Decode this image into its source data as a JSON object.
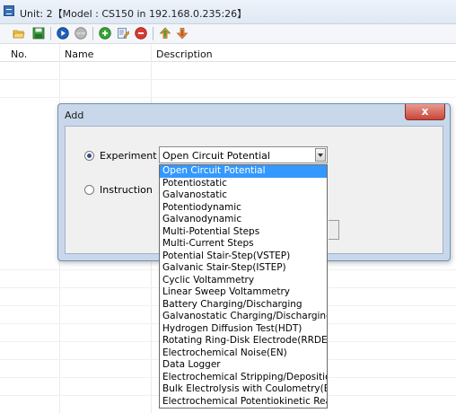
{
  "window": {
    "title": "Unit: 2【Model : CS150 in 192.168.0.235:26】"
  },
  "toolbar": {
    "icons": [
      "open-folder-icon",
      "save-icon",
      "play-icon",
      "stop-icon",
      "add-icon",
      "edit-icon",
      "remove-icon",
      "move-up-icon",
      "move-down-icon"
    ],
    "stop_text": "STOP"
  },
  "table": {
    "columns": [
      "No.",
      "Name",
      "Description"
    ]
  },
  "dialog": {
    "title": "Add",
    "close_label": "x",
    "experiment_label": "Experiment",
    "instruction_label": "Instruction",
    "experiment_checked": true,
    "combo_value": "Open Circuit Potential",
    "options": [
      "Open Circuit Potential",
      "Potentiostatic",
      "Galvanostatic",
      "Potentiodynamic",
      "Galvanodynamic",
      "Multi-Potential Steps",
      "Multi-Current Steps",
      "Potential Stair-Step(VSTEP)",
      "Galvanic Stair-Step(ISTEP)",
      "Cyclic Voltammetry",
      "Linear Sweep Voltammetry",
      "Battery Charging/Discharging",
      "Galvanostatic Charging/Discharging",
      "Hydrogen Diffusion Test(HDT)",
      "Rotating Ring-Disk Electrode(RRDE)",
      "Electrochemical Noise(EN)",
      "Data Logger",
      "Electrochemical Stripping/Deposition",
      "Bulk Electrolysis with Coulometry(BE)",
      "Electrochemical Potentiokinetic React"
    ],
    "selected_index": 0
  }
}
